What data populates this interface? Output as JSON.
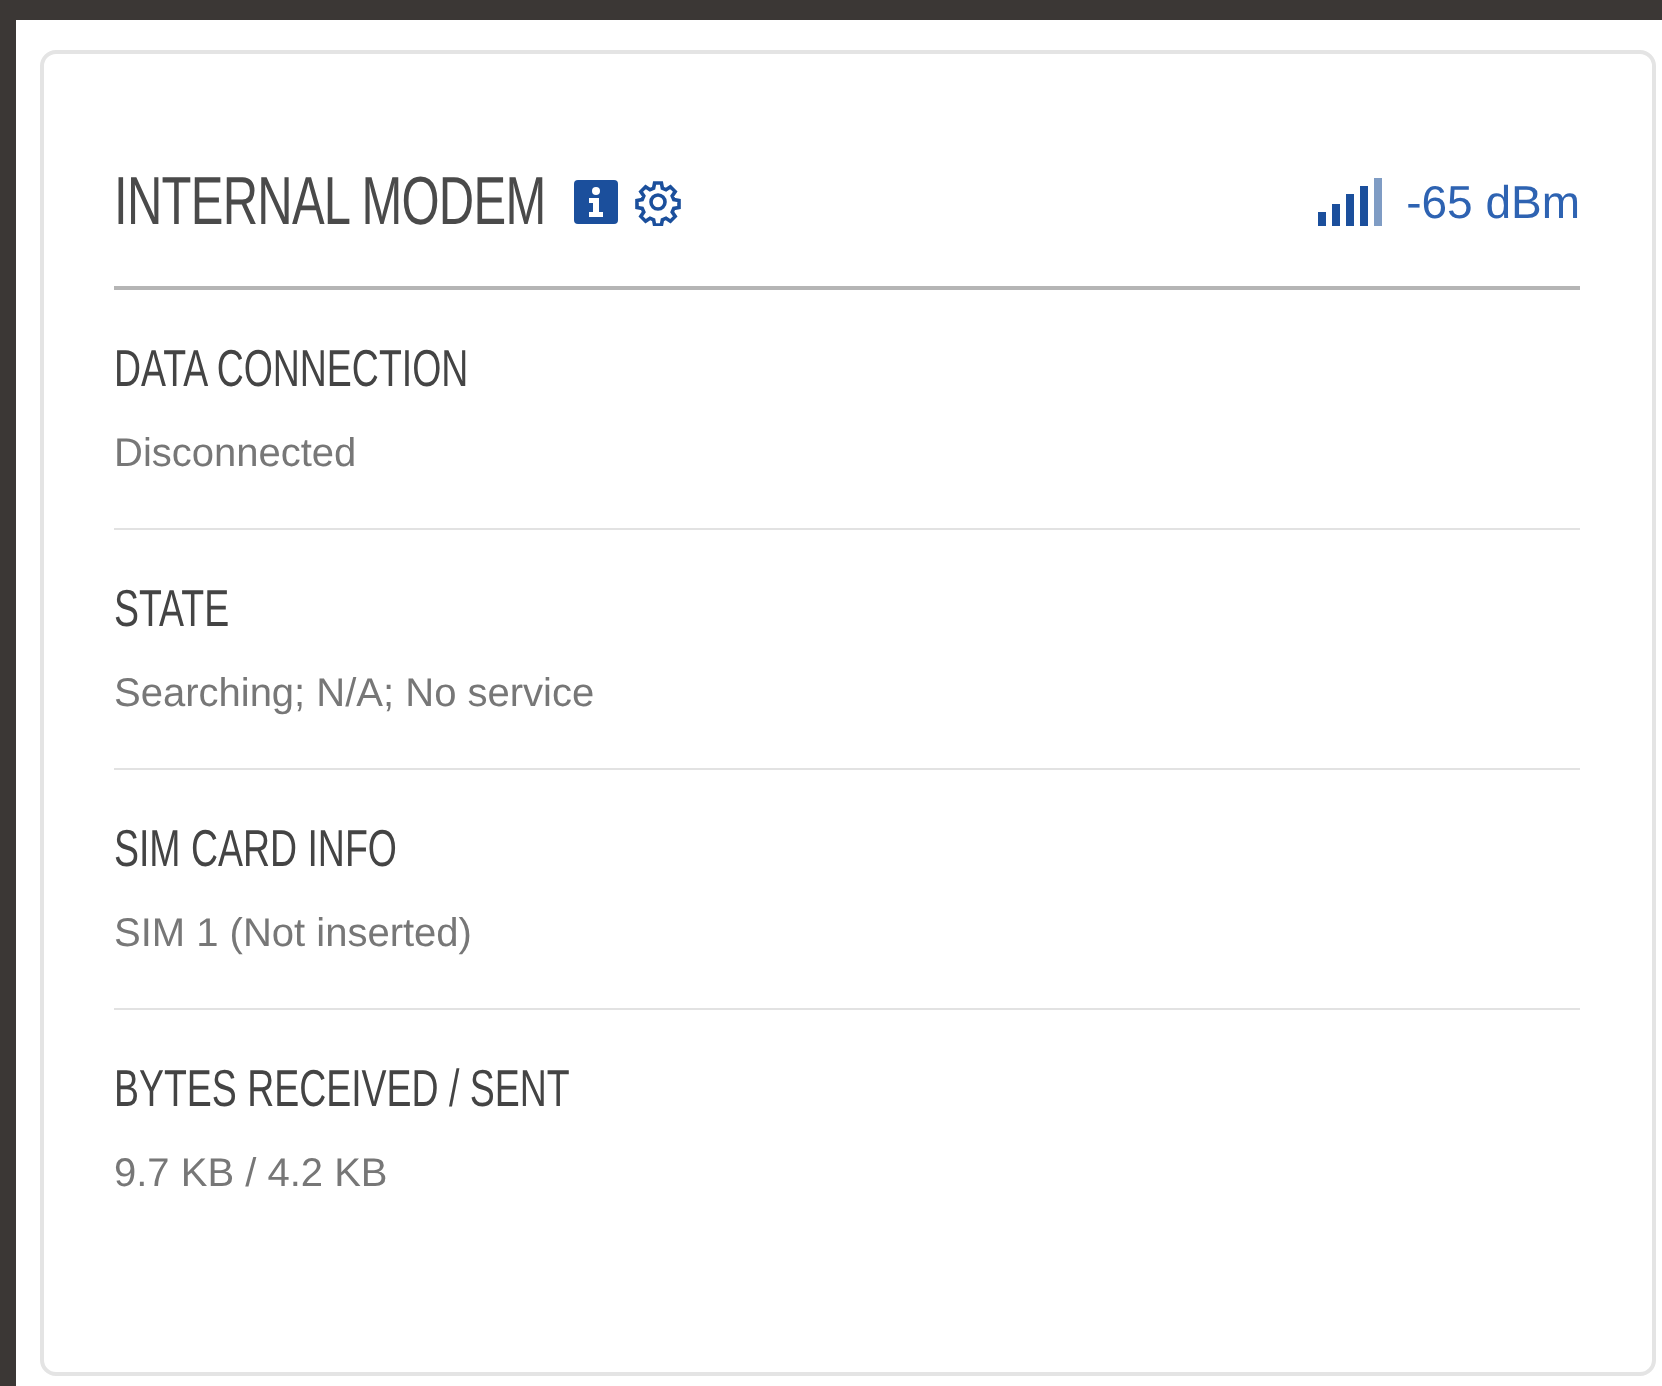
{
  "card": {
    "title": "INTERNAL MODEM",
    "signal": "-65 dBm",
    "fields": [
      {
        "label": "DATA CONNECTION",
        "value": "Disconnected"
      },
      {
        "label": "STATE",
        "value": "Searching; N/A; No service"
      },
      {
        "label": "SIM CARD INFO",
        "value": "SIM 1 (Not inserted)"
      },
      {
        "label": "BYTES RECEIVED / SENT",
        "value": "9.7 KB / 4.2 KB"
      }
    ]
  }
}
